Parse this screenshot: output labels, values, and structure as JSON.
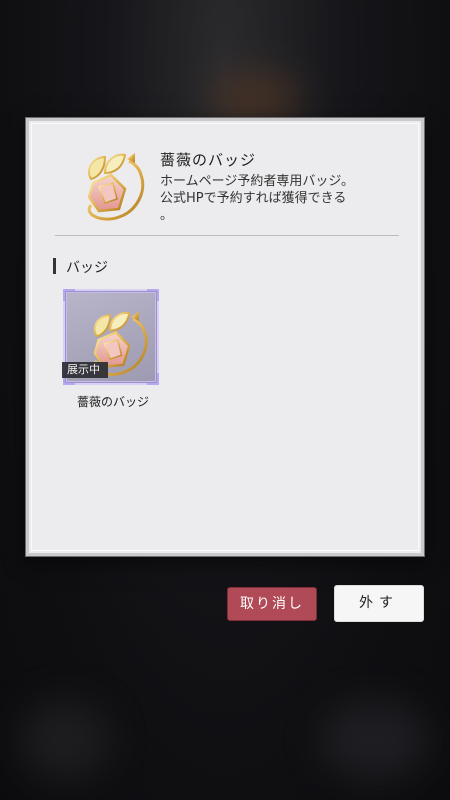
{
  "badge_detail": {
    "title": "薔薇のバッジ",
    "description_line1": "ホームページ予約者専用バッジ。",
    "description_line2": "公式HPで予約すれば獲得できる",
    "description_line3": "。",
    "icon": "rose-badge-icon"
  },
  "section": {
    "label": "バッジ"
  },
  "badges": [
    {
      "name": "薔薇のバッジ",
      "status_tag": "展示中",
      "icon": "rose-badge-icon",
      "selected": true
    }
  ],
  "buttons": {
    "cancel_label": "取り消し",
    "remove_label": "外す"
  },
  "colors": {
    "cancel_bg": "#b04a56",
    "selected_outline": "#b5a8ee",
    "dialog_bg": "#ececee"
  }
}
